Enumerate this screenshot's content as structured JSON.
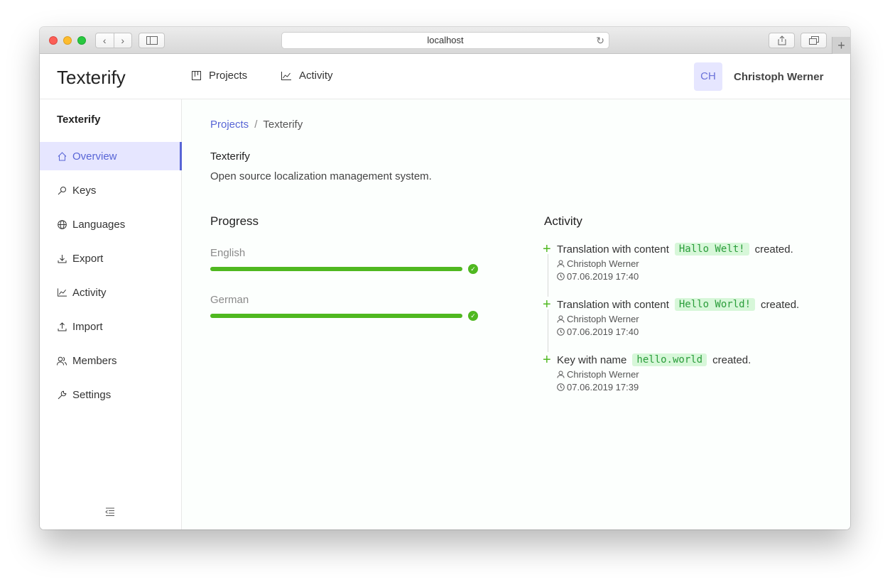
{
  "browser": {
    "url": "localhost",
    "nav_back": "‹",
    "nav_forward": "›",
    "reload": "↻",
    "new_tab": "+"
  },
  "header": {
    "brand": "Texterify",
    "nav": [
      {
        "label": "Projects",
        "icon": "board-icon"
      },
      {
        "label": "Activity",
        "icon": "chart-line-icon"
      }
    ],
    "avatar_initials": "CH",
    "username": "Christoph Werner"
  },
  "sidebar": {
    "title": "Texterify",
    "items": [
      {
        "label": "Overview",
        "icon": "home-icon",
        "active": true
      },
      {
        "label": "Keys",
        "icon": "key-icon"
      },
      {
        "label": "Languages",
        "icon": "globe-icon"
      },
      {
        "label": "Export",
        "icon": "download-icon"
      },
      {
        "label": "Activity",
        "icon": "chart-line-icon"
      },
      {
        "label": "Import",
        "icon": "upload-icon"
      },
      {
        "label": "Members",
        "icon": "users-icon"
      },
      {
        "label": "Settings",
        "icon": "wrench-icon"
      }
    ]
  },
  "main": {
    "breadcrumb": {
      "link": "Projects",
      "separator": "/",
      "current": "Texterify"
    },
    "project_name": "Texterify",
    "project_description": "Open source localization management system.",
    "progress": {
      "title": "Progress",
      "languages": [
        {
          "name": "English",
          "percent": 100
        },
        {
          "name": "German",
          "percent": 100
        }
      ]
    },
    "activity": {
      "title": "Activity",
      "items": [
        {
          "prefix": "Translation with content",
          "code": "Hallo Welt!",
          "suffix": "created.",
          "user": "Christoph Werner",
          "time": "07.06.2019 17:40"
        },
        {
          "prefix": "Translation with content",
          "code": "Hello World!",
          "suffix": "created.",
          "user": "Christoph Werner",
          "time": "07.06.2019 17:40"
        },
        {
          "prefix": "Key with name",
          "code": "hello.world",
          "suffix": "created.",
          "user": "Christoph Werner",
          "time": "07.06.2019 17:39"
        }
      ]
    }
  },
  "colors": {
    "accent": "#5865d6",
    "success": "#4fb820",
    "active_bg": "#e6e6ff"
  }
}
